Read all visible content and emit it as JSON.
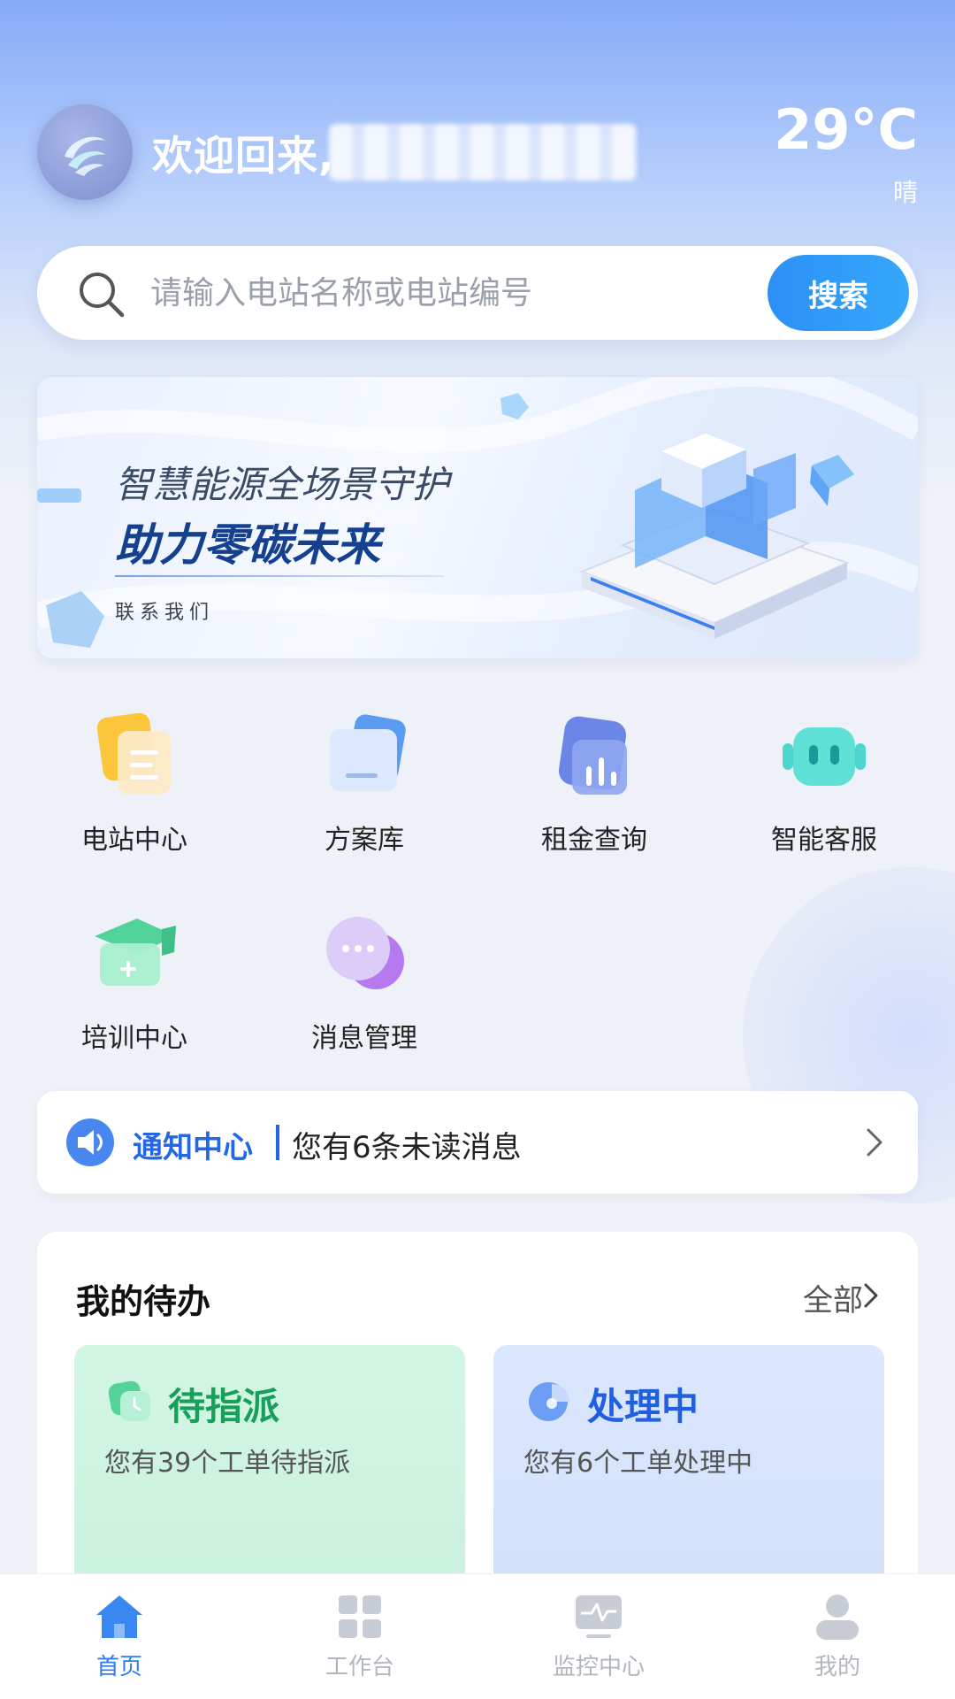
{
  "header": {
    "welcome": "欢迎回来,",
    "temperature": "29°C",
    "weather": "晴"
  },
  "search": {
    "placeholder": "请输入电站名称或电站编号",
    "button": "搜索"
  },
  "banner": {
    "line1": "智慧能源全场景守护",
    "line2": "助力零碳未来",
    "link": "联系我们"
  },
  "menu": {
    "items": [
      {
        "label": "电站中心",
        "icon": "document-icon"
      },
      {
        "label": "方案库",
        "icon": "folder-icon"
      },
      {
        "label": "租金查询",
        "icon": "chart-icon"
      },
      {
        "label": "智能客服",
        "icon": "robot-icon"
      },
      {
        "label": "培训中心",
        "icon": "graduation-cap-icon"
      },
      {
        "label": "消息管理",
        "icon": "chat-bubble-icon"
      }
    ]
  },
  "notice": {
    "title": "通知中心",
    "text": "您有6条未读消息"
  },
  "todo": {
    "title": "我的待办",
    "all": "全部",
    "cards": [
      {
        "title": "待指派",
        "subtitle": "您有39个工单待指派"
      },
      {
        "title": "处理中",
        "subtitle": "您有6个工单处理中"
      }
    ]
  },
  "tabbar": {
    "items": [
      {
        "label": "首页",
        "active": true
      },
      {
        "label": "工作台",
        "active": false
      },
      {
        "label": "监控中心",
        "active": false
      },
      {
        "label": "我的",
        "active": false
      }
    ]
  },
  "colors": {
    "primary": "#2d7cf0",
    "green": "#16a05a",
    "blue": "#2060e0"
  }
}
